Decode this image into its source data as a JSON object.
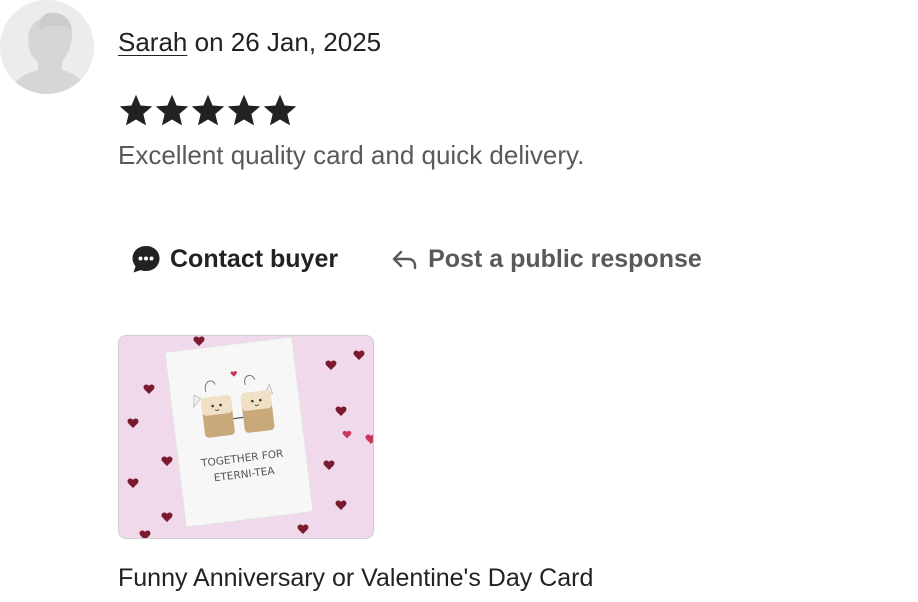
{
  "review": {
    "reviewer_name": "Sarah",
    "date_prefix": "on",
    "date": "26 Jan, 2025",
    "rating": 5,
    "rating_max": 5,
    "text": "Excellent quality card and quick delivery."
  },
  "actions": {
    "contact_label": "Contact buyer",
    "public_response_label": "Post a public response"
  },
  "product": {
    "title": "Funny Anniversary or Valentine's Day Card",
    "card_text_line1": "TOGETHER FOR",
    "card_text_line2": "ETERNI-TEA"
  },
  "colors": {
    "text_primary": "#222222",
    "text_secondary": "#595959",
    "thumb_background": "#f0d9ea",
    "heart": "#7a1a2e"
  },
  "icons": {
    "avatar": "default-user-avatar",
    "star": "star-filled-icon",
    "contact": "chat-bubble-icon",
    "reply": "reply-arrow-icon"
  }
}
